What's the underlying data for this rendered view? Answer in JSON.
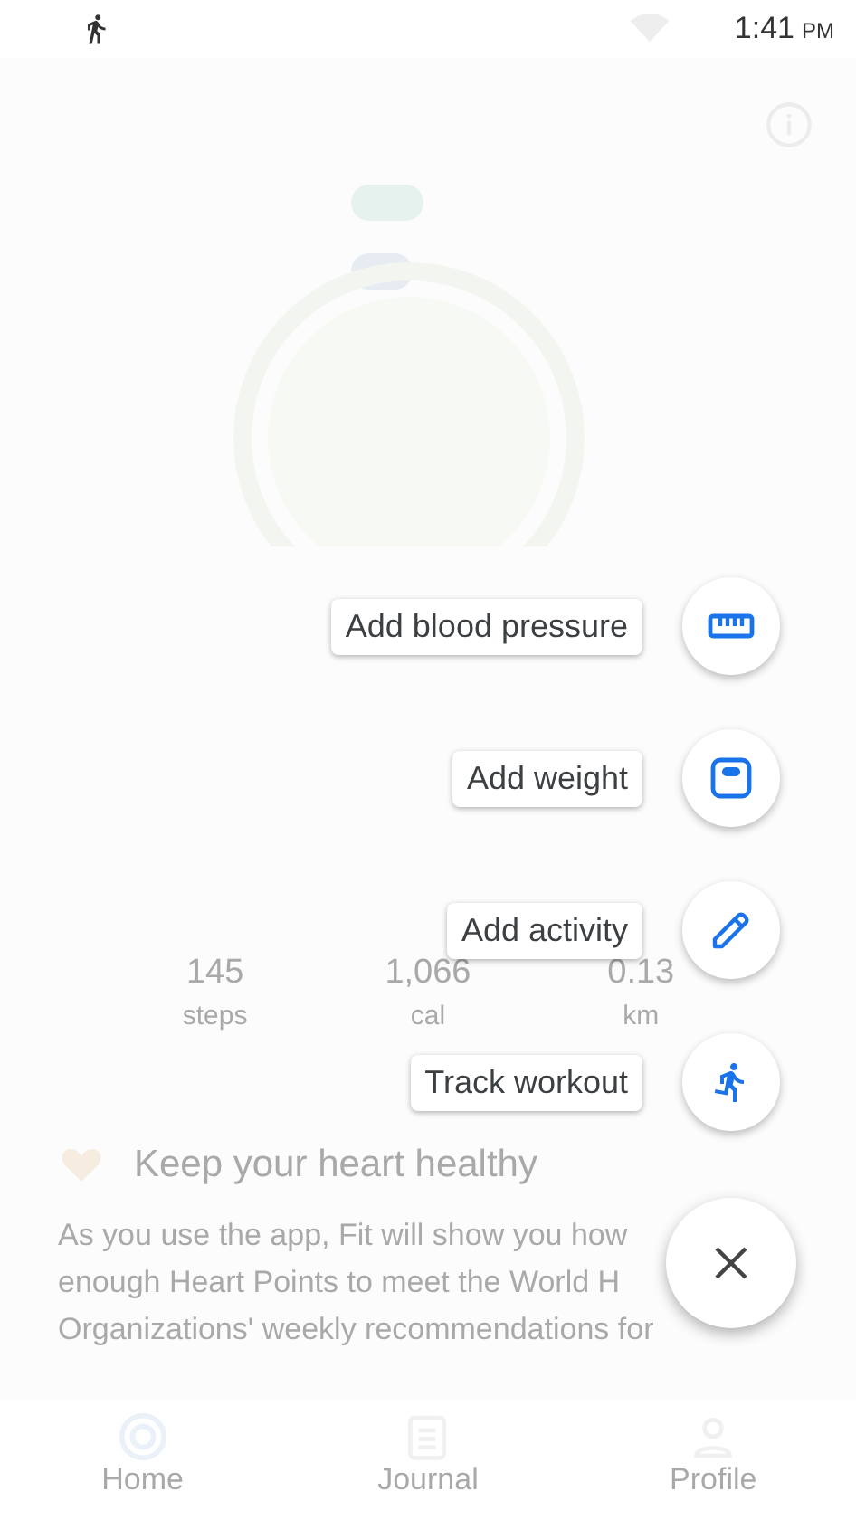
{
  "status_bar": {
    "time": "1:41",
    "period": "PM"
  },
  "stats": [
    {
      "value": "145",
      "unit": "steps"
    },
    {
      "value": "1,066",
      "unit": "cal"
    },
    {
      "value": "0.13",
      "unit": "km"
    }
  ],
  "card": {
    "title": "Keep your heart healthy",
    "lines": [
      "As you use the app, Fit will show you how",
      "enough Heart Points to meet the World H",
      "Organizations' weekly recommendations for"
    ]
  },
  "speed_dial": [
    {
      "label": "Add blood pressure",
      "kind": "blood_pressure"
    },
    {
      "label": "Add weight",
      "kind": "weight"
    },
    {
      "label": "Add activity",
      "kind": "activity"
    },
    {
      "label": "Track workout",
      "kind": "workout"
    }
  ],
  "nav": [
    {
      "label": "Home",
      "kind": "home"
    },
    {
      "label": "Journal",
      "kind": "journal"
    },
    {
      "label": "Profile",
      "kind": "profile"
    }
  ]
}
